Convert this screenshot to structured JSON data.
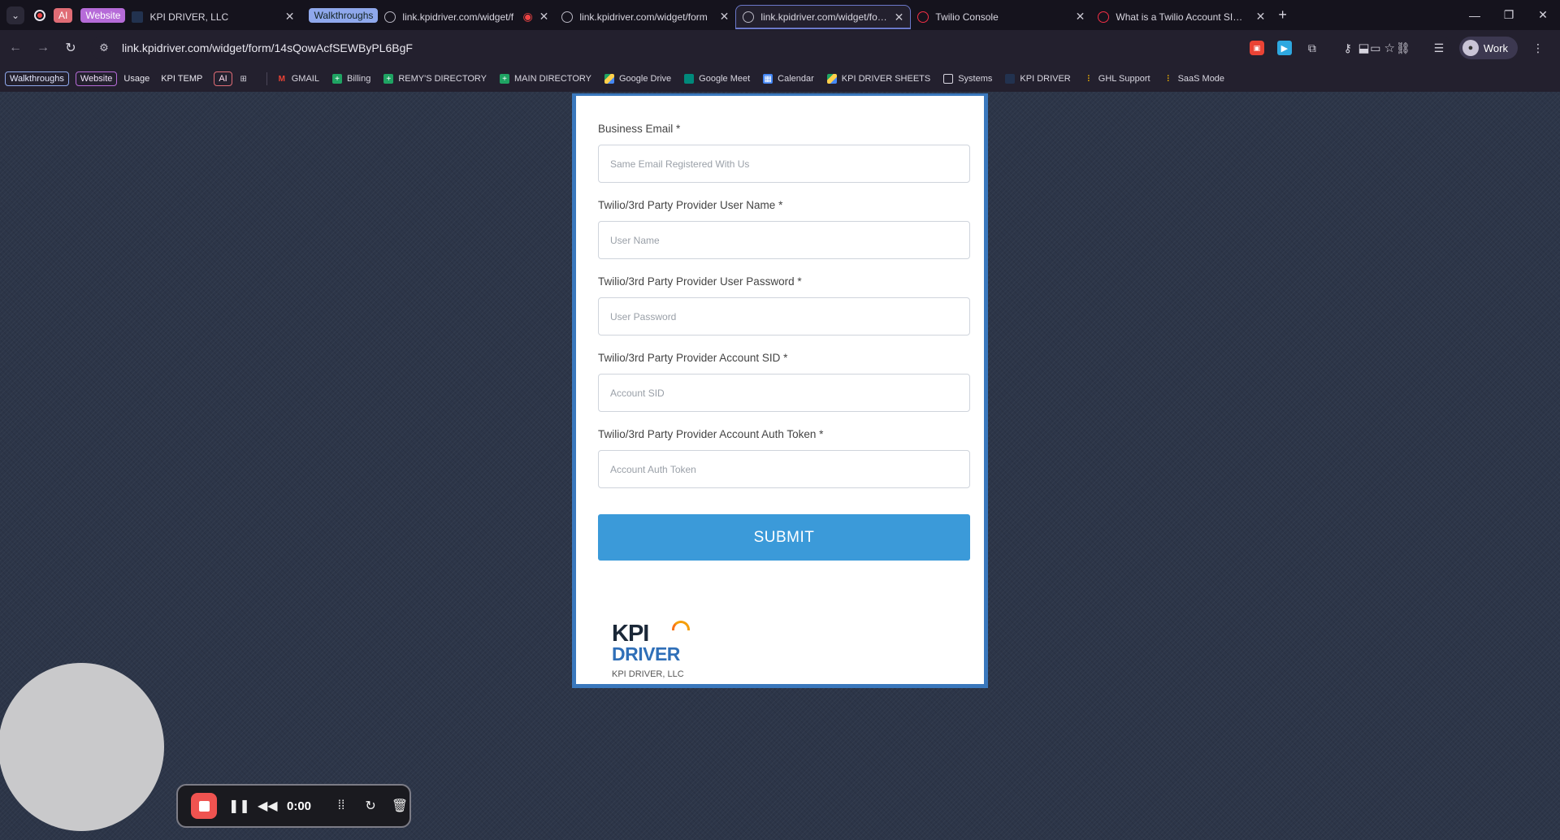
{
  "tabs": {
    "group_ai": "AI",
    "group_website": "Website",
    "group_walkthroughs": "Walkthroughs",
    "items": [
      {
        "title": "KPI DRIVER, LLC"
      },
      {
        "title": "link.kpidriver.com/widget/f"
      },
      {
        "title": "link.kpidriver.com/widget/form"
      },
      {
        "title": "link.kpidriver.com/widget/form"
      },
      {
        "title": "Twilio Console"
      },
      {
        "title": "What is a Twilio Account SID an"
      }
    ],
    "new_tab": "+"
  },
  "address": {
    "url": "link.kpidriver.com/widget/form/14sQowAcfSEWByPL6BgF"
  },
  "profile": {
    "label": "Work"
  },
  "bookmarks": {
    "chips": [
      "Walkthroughs",
      "Website"
    ],
    "plain": [
      "Usage",
      "KPI TEMP"
    ],
    "ai_chip": "AI",
    "items": [
      {
        "label": "GMAIL",
        "icon": "gmail-icon"
      },
      {
        "label": "Billing",
        "icon": "sheets-icon"
      },
      {
        "label": "REMY'S DIRECTORY",
        "icon": "sheets-icon"
      },
      {
        "label": "MAIN DIRECTORY",
        "icon": "sheets-icon"
      },
      {
        "label": "Google Drive",
        "icon": "drive-icon"
      },
      {
        "label": "Google Meet",
        "icon": "meet-icon"
      },
      {
        "label": "Calendar",
        "icon": "calendar-icon"
      },
      {
        "label": "KPI DRIVER SHEETS",
        "icon": "drive-icon"
      },
      {
        "label": "Systems",
        "icon": "folder-icon"
      },
      {
        "label": "KPI DRIVER",
        "icon": "kpi-icon"
      },
      {
        "label": "GHL Support",
        "icon": "ghl-icon"
      },
      {
        "label": "SaaS Mode",
        "icon": "ghl-icon"
      }
    ]
  },
  "form": {
    "fields": [
      {
        "label": "Business Email *",
        "placeholder": "Same Email Registered With Us"
      },
      {
        "label": "Twilio/3rd Party Provider User Name *",
        "placeholder": "User Name"
      },
      {
        "label": "Twilio/3rd Party Provider User Password *",
        "placeholder": "User Password"
      },
      {
        "label": "Twilio/3rd Party Provider Account SID *",
        "placeholder": "Account SID"
      },
      {
        "label": "Twilio/3rd Party Provider Account Auth Token *",
        "placeholder": "Account Auth Token"
      }
    ],
    "submit_label": "SUBMIT",
    "logo_line1": "KPI",
    "logo_line2": "DRIVER",
    "company": "KPI DRIVER, LLC"
  },
  "recorder": {
    "time": "0:00"
  },
  "colors": {
    "submit": "#3b9ad9",
    "card_border": "#3a78bd",
    "stop": "#ef5350"
  }
}
